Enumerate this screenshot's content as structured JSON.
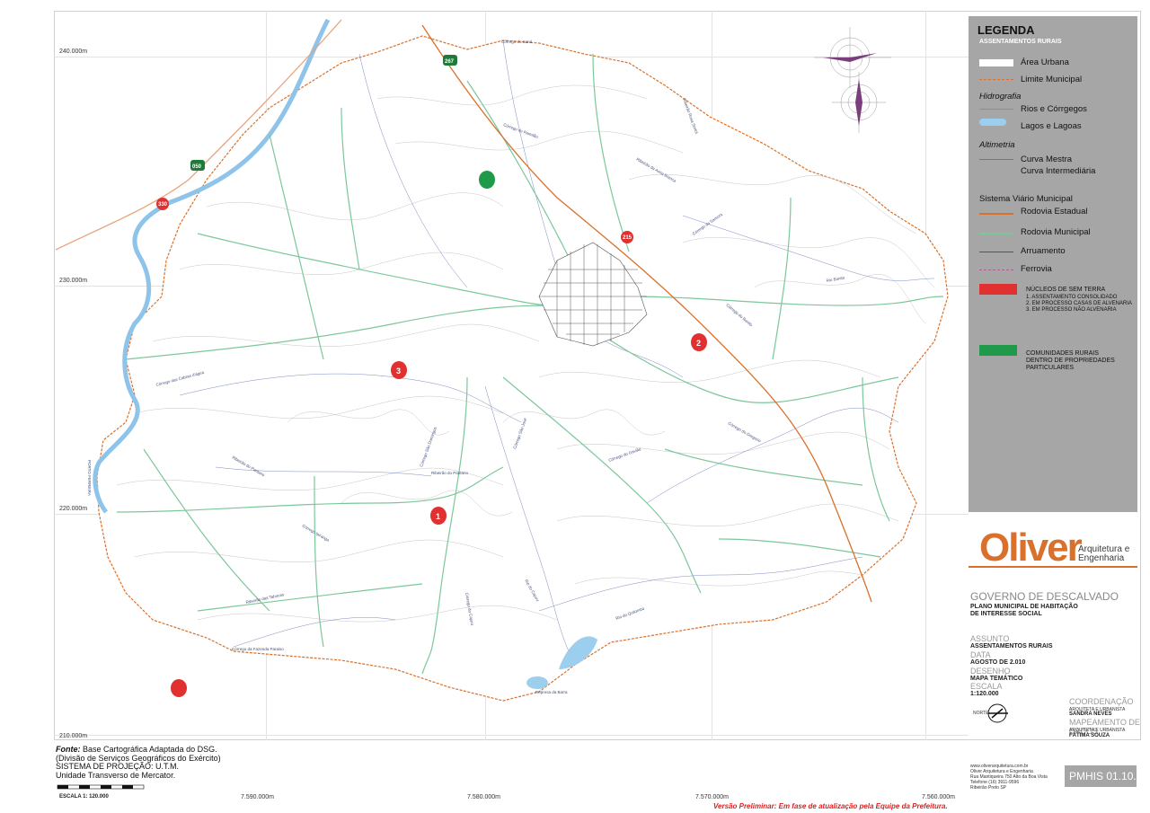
{
  "map": {
    "y_ticks": [
      "240.000m",
      "230.000m",
      "220.000m",
      "210.000m"
    ],
    "x_ticks": [
      "7.590.000m",
      "7.580.000m",
      "7.570.000m",
      "7.560.000m"
    ],
    "highways": [
      "267",
      "050",
      "330",
      "215"
    ],
    "nucleos": [
      "1",
      "2",
      "3"
    ],
    "places": [
      "Córrego do Saná",
      "Ribeirão Rosa Sortol",
      "Ribeirão da Areia Branca",
      "Córrego da Samora",
      "Córrego do Bonito",
      "Rio Bonito",
      "Córrego do Gregorio",
      "Córrego do Gavião",
      "Ribeirão do Pantano",
      "Ribeirão do Pantano",
      "Córrego São Domingos",
      "Córrego das Cabras d'água",
      "Córrego do Cajuru",
      "Represa da Barra",
      "Córrego da Fazenda Paraiso",
      "Ribeirão das Tabocas",
      "Córrego Ipiranga",
      "Rio do Quilombo",
      "PORTO FERREIRA",
      "Córrego do Paredão",
      "Córrego São José",
      "Rio do Cajuru"
    ]
  },
  "legend": {
    "title": "LEGENDA",
    "subtitle": "ASSENTAMENTOS RURAIS",
    "area_urbana": "Área Urbana",
    "limite_municipal": "Limite Municipal",
    "hidrografia": "Hidrografia",
    "rios": "Rios e Córrgegos",
    "lagos": "Lagos e Lagoas",
    "altimetria": "Altimetria",
    "curva_mestra": "Curva Mestra",
    "curva_intermediaria": "Curva Intermediária",
    "sistema_viario": "Sistema Viário Municipal",
    "rodovia_estadual": "Rodovia Estadual",
    "rodovia_municipal": "Rodovia Municipal",
    "arruamento": "Arruamento",
    "ferrovia": "Ferrovia",
    "nucleos_title": "NÚCLEOS DE SEM TERRA",
    "nucleos_items": [
      "1. ASSENTAMENTO CONSOLIDADO",
      "2. EM PROCESSO CASAS DE ALVENARIA",
      "3. EM PROCESSO NÃO ALVENARIA"
    ],
    "comunidades": [
      "COMUNIDADES RURAIS",
      "DENTRO DE PROPRIEDADES",
      "PARTICULARES"
    ],
    "colors": {
      "red": "#e03030",
      "green": "#1f9a4a",
      "orange": "#d9702b",
      "road_green": "#7cc79a",
      "water": "#9ccfee"
    }
  },
  "title_block": {
    "logo": "Oliver",
    "logo_sub1": "Arquitetura e",
    "logo_sub2": "Engenharia",
    "governo": "GOVERNO DE DESCALVADO",
    "plano1": "PLANO MUNICIPAL DE HABITAÇÃO",
    "plano2": "DE INTERESSE SOCIAL",
    "assunto_lab": "ASSUNTO",
    "assunto": "ASSENTAMENTOS RURAIS",
    "data_lab": "DATA",
    "data": "AGOSTO DE 2.010",
    "desenho_lab": "DESENHO",
    "desenho": "MAPA   TEMÁTICO",
    "escala_lab": "ESCALA",
    "escala": "1:120.000",
    "coord_lab": "COORDENAÇÃO",
    "coord_role": "ARQUITETA E URBANISTA",
    "coord_name": "SANDRA NEVES",
    "mapeamento_lab": "MAPEAMENTO DE DADOS",
    "map_role": "ARQUITETA E URBANISTA",
    "map_name": "FÁTIMA SOUZA",
    "north": "NORTE",
    "contact": [
      "www.oliverarquitetura.com.br",
      "Oliver Arquitetura e Engenharia",
      "Rua Mantiqueira 750 Alto da Boa Vista",
      "Telefone (16) 3911-9596",
      "Ribeirão Preto SP"
    ],
    "code": "PMHIS 01.10."
  },
  "source": {
    "fonte_lab": "Fonte:",
    "fonte": " Base Cartográfica Adaptada do DSG.",
    "line2": "(Divisão de Serviços Geográficos do Exército)",
    "line3": "SISTEMA DE PROJEÇÃO: U.T.M.",
    "line4": "Unidade Transverso de Mercator.",
    "scale": "ESCALA 1: 120.000"
  },
  "footer": {
    "preliminar": "Versão Preliminar:  Em fase de atualização pela Equipe da Prefeitura."
  }
}
